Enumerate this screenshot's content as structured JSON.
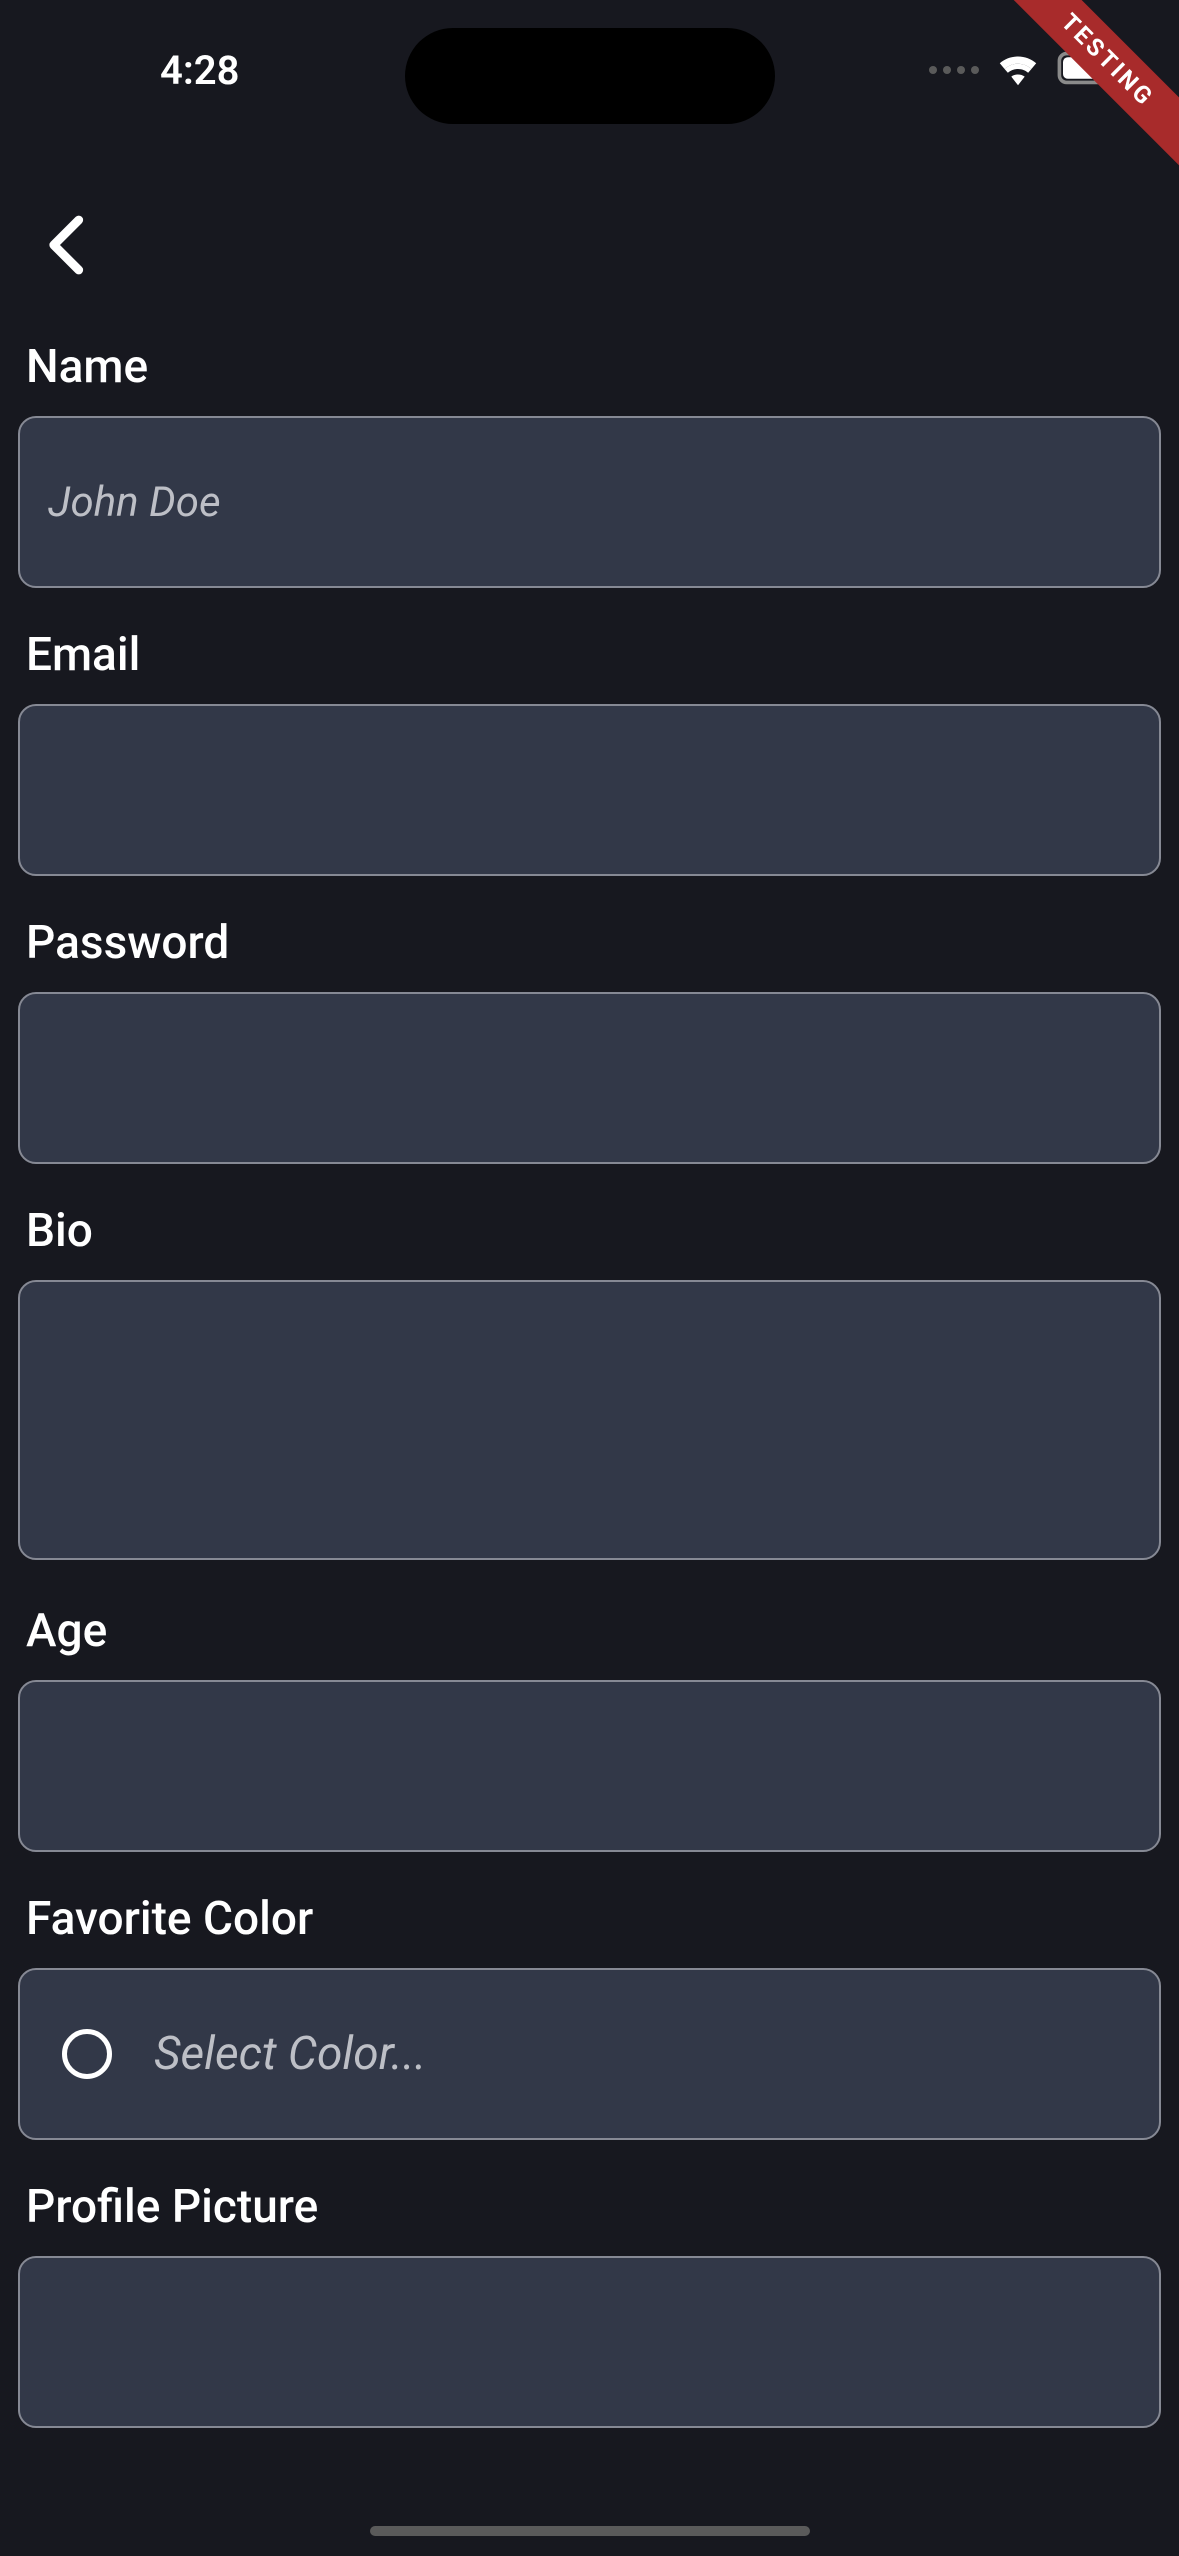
{
  "statusBar": {
    "time": "4:28"
  },
  "ribbon": {
    "text": "TESTING"
  },
  "form": {
    "name": {
      "label": "Name",
      "placeholder": "John Doe",
      "value": ""
    },
    "email": {
      "label": "Email",
      "placeholder": "",
      "value": ""
    },
    "password": {
      "label": "Password",
      "placeholder": "",
      "value": ""
    },
    "bio": {
      "label": "Bio",
      "placeholder": "",
      "value": ""
    },
    "age": {
      "label": "Age",
      "placeholder": "",
      "value": ""
    },
    "favoriteColor": {
      "label": "Favorite Color",
      "placeholder": "Select Color..."
    },
    "profilePicture": {
      "label": "Profile Picture"
    }
  }
}
